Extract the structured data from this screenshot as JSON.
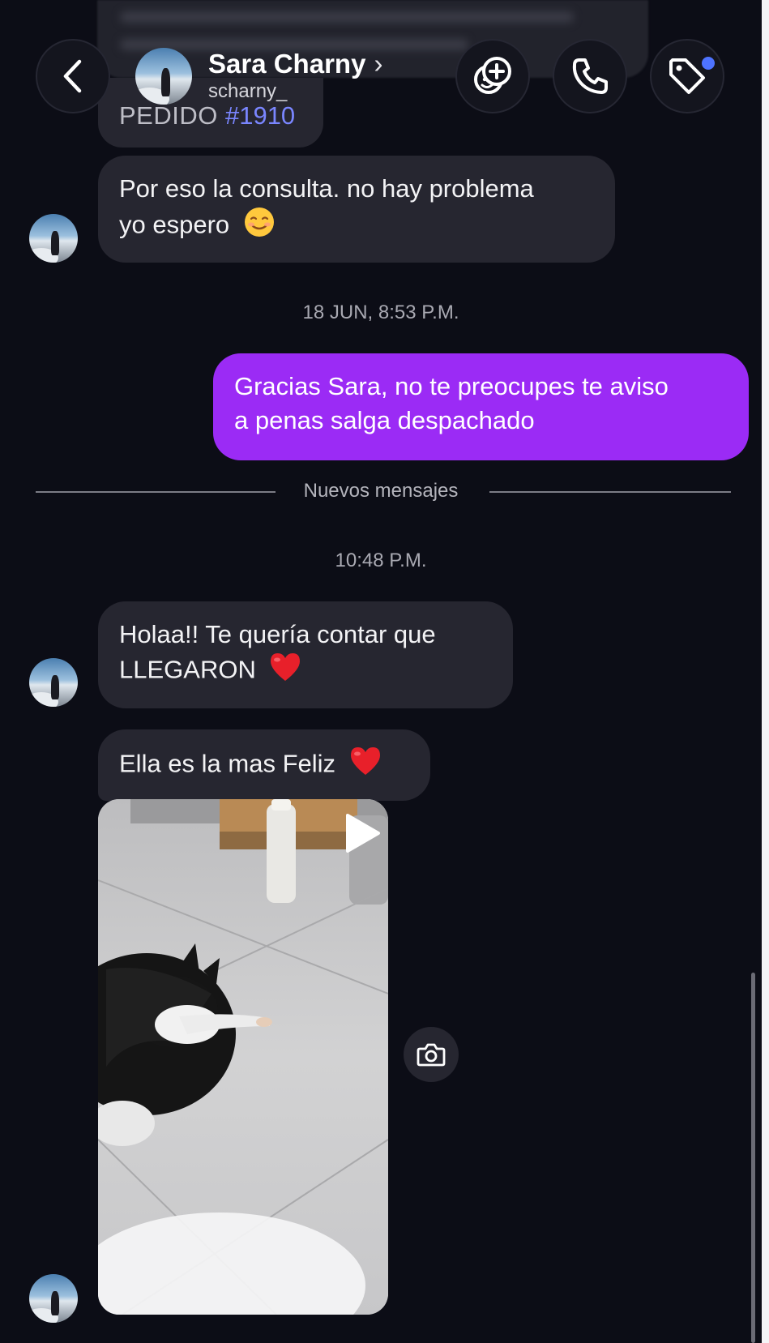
{
  "header": {
    "back_label": "back",
    "contact_name": "Sara Charny",
    "contact_chevron": "›",
    "contact_handle": "scharny_",
    "actions": [
      {
        "icon": "add-reaction-icon"
      },
      {
        "icon": "phone-icon"
      },
      {
        "icon": "tag-icon",
        "badge_color": "#4e73ff"
      }
    ]
  },
  "messages": {
    "partial_order": {
      "prefix": "PEDIDO ",
      "number": "#1910"
    },
    "m1": {
      "line1": "Por eso la consulta. no hay problema",
      "line2": "yo espero",
      "emoji": "☺️"
    },
    "ts1": "18 JUN, 8:53 P.M.",
    "m2": {
      "line1": "Gracias Sara, no te preocupes te aviso",
      "line2": "a penas salga despachado"
    },
    "new_messages_label": "Nuevos mensajes",
    "ts2": "10:48 P.M.",
    "m3": {
      "line1": "Holaa!! Te quería contar que",
      "line2": "LLEGARON",
      "emoji": "❤️"
    },
    "m4": {
      "text": "Ella es la mas Feliz",
      "emoji": "❤️"
    }
  },
  "colors": {
    "background": "#0c0d16",
    "incoming_bubble": "#262630",
    "outgoing_bubble": "#9b2bf5",
    "link_accent": "#7a86ff"
  }
}
